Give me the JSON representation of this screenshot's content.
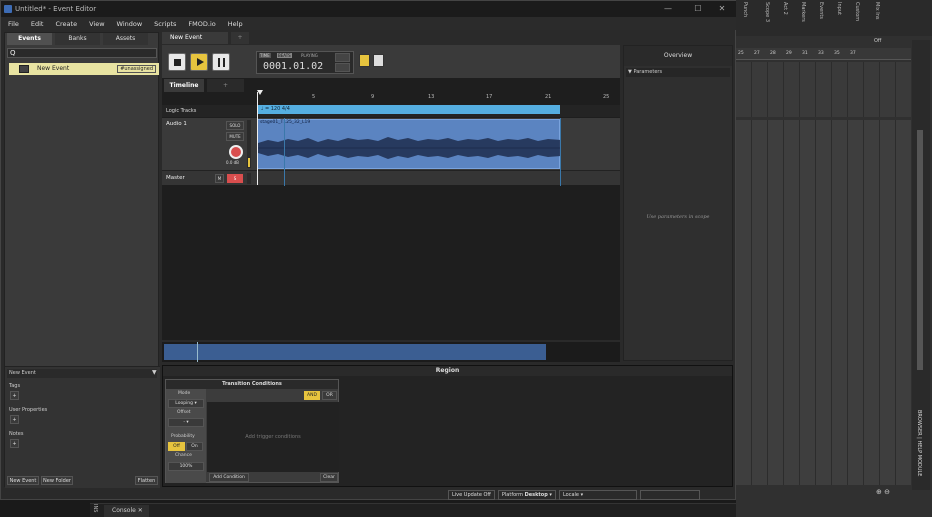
{
  "titlebar": {
    "title": "Untitled* - Event Editor",
    "min": "—",
    "max": "☐",
    "close": "✕"
  },
  "menu": [
    "File",
    "Edit",
    "Create",
    "View",
    "Window",
    "Scripts",
    "FMOD.io",
    "Help"
  ],
  "left": {
    "tabs": [
      "Events",
      "Banks",
      "Assets"
    ],
    "search_icon": "Q",
    "event": {
      "name": "New Event",
      "badge": "#unassigned"
    },
    "details_title": "New Event",
    "sections": [
      "Tags",
      "User Properties",
      "Notes"
    ],
    "buttons": {
      "new_event": "New Event",
      "new_folder": "New Folder",
      "flatten": "Flatten"
    }
  },
  "editor": {
    "event_tab": "New Event",
    "add_tab": "+",
    "counter": {
      "time": "TIME",
      "beats": "BEATS",
      "status": "PLAYING",
      "value": "0001.01.02"
    },
    "subtabs": [
      "Timeline",
      "+"
    ]
  },
  "timeline": {
    "ruler": [
      "5",
      "9",
      "13",
      "17",
      "21",
      "25"
    ],
    "logic_tracks": "Logic Tracks",
    "tempo": "♩ = 120 4/4",
    "audio_track": "Audio 1",
    "solo": "SOLO",
    "mute": "MUTE",
    "gain": "0.0 dB",
    "clip_name": "stage01_T125_32_L19",
    "master": "Master",
    "m": "M",
    "s": "S"
  },
  "overview": {
    "title": "Overview",
    "parameters": "Parameters",
    "empty": "Use parameters in scope"
  },
  "region": {
    "title": "Region",
    "tc_title": "Transition Conditions",
    "mode_label": "Mode",
    "mode_value": "Looping",
    "offset_label": "Offset",
    "offset_value": "-",
    "probability_label": "Probability",
    "off": "Off",
    "on": "On",
    "chance_label": "Chance",
    "chance_value": "100%",
    "and": "AND",
    "or": "OR",
    "placeholder": "Add trigger conditions",
    "add_condition": "Add Condition",
    "clear": "Clear"
  },
  "status": {
    "live_update": "Live Update Off",
    "platform_label": "Platform",
    "platform": "Desktop",
    "locale_label": "Locale"
  },
  "console": {
    "tab": "Console",
    "side": "INS"
  },
  "daw": {
    "track_names": [
      "Punch",
      "Scope 3",
      "Act 2",
      "Markers",
      "Events",
      "Input",
      "Custom",
      "Mix Ins"
    ],
    "ruler": [
      "25",
      "27",
      "28",
      "29",
      "31",
      "33",
      "35",
      "37"
    ],
    "browser": "BROWSER | HELP MODULE",
    "off": "Off"
  },
  "colors": {
    "accent": "#e7c43e",
    "clip": "#5b84c1",
    "tempo": "#55aee0"
  }
}
